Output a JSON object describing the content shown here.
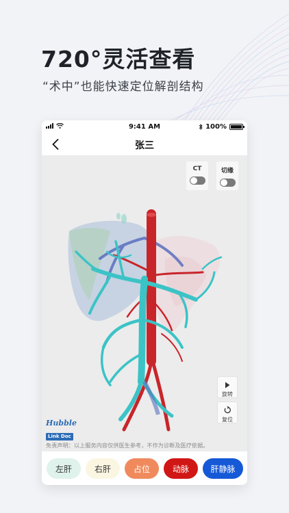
{
  "promo": {
    "title": "720°灵活查看",
    "subtitle": "“术中”也能快速定位解剖结构"
  },
  "status_bar": {
    "time": "9:41 AM",
    "battery": "100%"
  },
  "nav": {
    "title": "张三"
  },
  "toggles": [
    {
      "label": "CT",
      "on": false
    },
    {
      "label": "切缘",
      "on": false
    }
  ],
  "controls": {
    "rotate_label": "旋转",
    "reset_label": "复位"
  },
  "logo": {
    "word": "Hubble",
    "badge": "Link Doc"
  },
  "disclaimer": "免责声明：以上服务内容仅供医生参考，不作为诊断及医疗依据。",
  "buttons": [
    {
      "label": "左肝",
      "bg": "#dff2ec",
      "color": "#333333"
    },
    {
      "label": "右肝",
      "bg": "#fbf6e2",
      "color": "#333333"
    },
    {
      "label": "占位",
      "bg": "#f08a5d",
      "color": "#ffffff"
    },
    {
      "label": "动脉",
      "bg": "#d11616",
      "color": "#ffffff"
    },
    {
      "label": "肝静脉",
      "bg": "#1559d6",
      "color": "#ffffff"
    }
  ],
  "colors": {
    "artery": "#c8252a",
    "portal_vein": "#3cc3c6",
    "hepatic_vein": "#5a6fbf"
  }
}
